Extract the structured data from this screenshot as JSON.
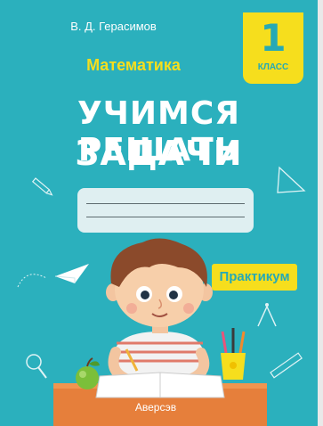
{
  "book": {
    "author": "В. Д. Герасимов",
    "subject": "Математика",
    "title_line1": "УЧИМСЯ РЕШАТЬ",
    "title_line2": "ЗАДАЧИ",
    "grade_number": "1",
    "grade_label": "КЛАСС",
    "series_badge": "Практикум",
    "publisher": "Аверсэв"
  },
  "colors": {
    "cover_background": "#2bb0bd",
    "accent_yellow": "#f6de1d",
    "title_text": "#ffffff",
    "name_box": "#dfeff1"
  },
  "icons": [
    "pencil-icon",
    "compass-icon",
    "triangle-ruler-icon",
    "paper-plane-icon",
    "magnifier-icon",
    "ruler-icon",
    "apple-icon",
    "pencil-cup-icon"
  ]
}
